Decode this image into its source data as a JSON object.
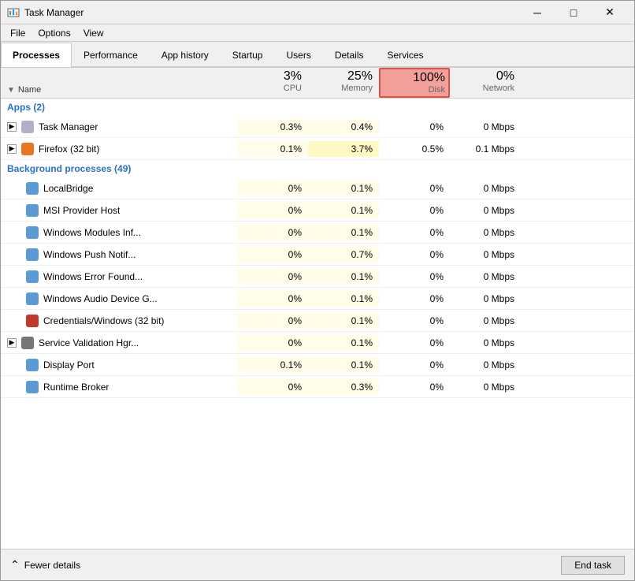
{
  "window": {
    "title": "Task Manager",
    "controls": {
      "minimize": "─",
      "maximize": "□",
      "close": "✕"
    }
  },
  "menu": {
    "items": [
      "File",
      "Options",
      "View"
    ]
  },
  "tabs": [
    {
      "id": "processes",
      "label": "Processes",
      "active": true
    },
    {
      "id": "performance",
      "label": "Performance",
      "active": false
    },
    {
      "id": "app-history",
      "label": "App history",
      "active": false
    },
    {
      "id": "startup",
      "label": "Startup",
      "active": false
    },
    {
      "id": "users",
      "label": "Users",
      "active": false
    },
    {
      "id": "details",
      "label": "Details",
      "active": false
    },
    {
      "id": "services",
      "label": "Services",
      "active": false
    }
  ],
  "columns": {
    "name": "Name",
    "cpu": {
      "percent": "3%",
      "label": "CPU"
    },
    "memory": {
      "percent": "25%",
      "label": "Memory"
    },
    "disk": {
      "percent": "100%",
      "label": "Disk"
    },
    "network": {
      "percent": "0%",
      "label": "Network"
    }
  },
  "sections": [
    {
      "title": "Apps (2)",
      "rows": [
        {
          "name": "Task Manager",
          "icon_color": "#b0b0c8",
          "expandable": true,
          "cpu": "0.3%",
          "memory": "0.4%",
          "disk": "0%",
          "network": "0 Mbps",
          "cpu_bg": "yellow-light",
          "mem_bg": "yellow-light"
        },
        {
          "name": "Firefox (32 bit)",
          "icon_color": "#e87722",
          "expandable": true,
          "cpu": "0.1%",
          "memory": "3.7%",
          "disk": "0.5%",
          "network": "0.1 Mbps",
          "cpu_bg": "yellow-light",
          "mem_bg": "yellow-med"
        }
      ]
    },
    {
      "title": "Background processes (49)",
      "rows": [
        {
          "name": "LocalBridge",
          "icon_color": "#5b9bd5",
          "expandable": false,
          "cpu": "0%",
          "memory": "0.1%",
          "disk": "0%",
          "network": "0 Mbps",
          "cpu_bg": "yellow-light",
          "mem_bg": "yellow-light"
        },
        {
          "name": "MSI Provider Host",
          "icon_color": "#5b9bd5",
          "expandable": false,
          "cpu": "0%",
          "memory": "0.1%",
          "disk": "0%",
          "network": "0 Mbps",
          "cpu_bg": "yellow-light",
          "mem_bg": "yellow-light"
        },
        {
          "name": "Windows Modules Inf...",
          "icon_color": "#5b9bd5",
          "expandable": false,
          "cpu": "0%",
          "memory": "0.1%",
          "disk": "0%",
          "network": "0 Mbps",
          "cpu_bg": "yellow-light",
          "mem_bg": "yellow-light"
        },
        {
          "name": "Windows Push Notif...",
          "icon_color": "#5b9bd5",
          "expandable": false,
          "cpu": "0%",
          "memory": "0.7%",
          "disk": "0%",
          "network": "0 Mbps",
          "cpu_bg": "yellow-light",
          "mem_bg": "yellow-light"
        },
        {
          "name": "Windows Error Found...",
          "icon_color": "#5b9bd5",
          "expandable": false,
          "cpu": "0%",
          "memory": "0.1%",
          "disk": "0%",
          "network": "0 Mbps",
          "cpu_bg": "yellow-light",
          "mem_bg": "yellow-light"
        },
        {
          "name": "Windows Audio Device G...",
          "icon_color": "#5b9bd5",
          "expandable": false,
          "cpu": "0%",
          "memory": "0.1%",
          "disk": "0%",
          "network": "0 Mbps",
          "cpu_bg": "yellow-light",
          "mem_bg": "yellow-light"
        },
        {
          "name": "Credentials/Windows (32 bit)",
          "icon_color": "#c0392b",
          "expandable": false,
          "cpu": "0%",
          "memory": "0.1%",
          "disk": "0%",
          "network": "0 Mbps",
          "cpu_bg": "yellow-light",
          "mem_bg": "yellow-light"
        },
        {
          "name": "Service Validation Hgr...",
          "icon_color": "#777",
          "expandable": true,
          "cpu": "0%",
          "memory": "0.1%",
          "disk": "0%",
          "network": "0 Mbps",
          "cpu_bg": "yellow-light",
          "mem_bg": "yellow-light"
        },
        {
          "name": "Display Port",
          "icon_color": "#5b9bd5",
          "expandable": false,
          "cpu": "0.1%",
          "memory": "0.1%",
          "disk": "0%",
          "network": "0 Mbps",
          "cpu_bg": "yellow-light",
          "mem_bg": "yellow-light"
        },
        {
          "name": "Runtime Broker",
          "icon_color": "#5b9bd5",
          "expandable": false,
          "cpu": "0%",
          "memory": "0.3%",
          "disk": "0%",
          "network": "0 Mbps",
          "cpu_bg": "yellow-light",
          "mem_bg": "yellow-light"
        }
      ]
    }
  ],
  "footer": {
    "fewer_details": "Fewer details",
    "end_task": "End task",
    "chevron_up": "⌃"
  }
}
